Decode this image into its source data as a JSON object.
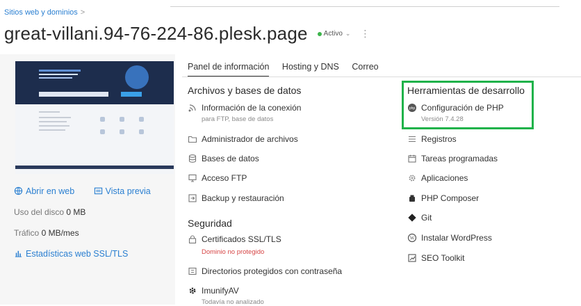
{
  "breadcrumb": {
    "label": "Sitios web y dominios",
    "separator": ">"
  },
  "header": {
    "title": "great-villani.94-76-224-86.plesk.page",
    "status": "Activo",
    "status_color": "#3cb44b"
  },
  "left": {
    "open_web": "Abrir en web",
    "preview": "Vista previa",
    "disk_label": "Uso del disco",
    "disk_value": "0 MB",
    "traffic_label": "Tráfico",
    "traffic_value": "0 MB/mes",
    "stats_link": "Estadísticas web SSL/TLS"
  },
  "tabs": [
    "Panel de información",
    "Hosting y DNS",
    "Correo"
  ],
  "files_section": {
    "title": "Archivos y bases de datos",
    "items": [
      {
        "label": "Información de la conexión",
        "sub": "para FTP, base de datos",
        "icon": "connection-icon"
      },
      {
        "label": "Administrador de archivos",
        "icon": "folder-icon"
      },
      {
        "label": "Bases de datos",
        "icon": "database-icon"
      },
      {
        "label": "Acceso FTP",
        "icon": "ftp-icon"
      },
      {
        "label": "Backup y restauración",
        "icon": "backup-icon"
      }
    ]
  },
  "security_section": {
    "title": "Seguridad",
    "items": [
      {
        "label": "Certificados SSL/TLS",
        "sub": "Dominio no protegido",
        "icon": "lock-icon"
      },
      {
        "label": "Directorios protegidos con contraseña",
        "icon": "protected-folder-icon"
      },
      {
        "label": "ImunifyAV",
        "sub": "Todavía no analizado",
        "icon": "gear-icon"
      }
    ]
  },
  "dev_section": {
    "title": "Herramientas de desarrollo",
    "highlight_color": "#1fb24a",
    "items": [
      {
        "label": "Configuración de PHP",
        "sub": "Versión 7.4.28",
        "icon": "php-icon"
      },
      {
        "label": "Registros",
        "icon": "logs-icon"
      },
      {
        "label": "Tareas programadas",
        "icon": "calendar-icon"
      },
      {
        "label": "Aplicaciones",
        "icon": "apps-icon"
      },
      {
        "label": "PHP Composer",
        "icon": "composer-icon"
      },
      {
        "label": "Git",
        "icon": "git-icon"
      },
      {
        "label": "Instalar WordPress",
        "icon": "wordpress-icon"
      },
      {
        "label": "SEO Toolkit",
        "icon": "seo-icon"
      }
    ]
  }
}
